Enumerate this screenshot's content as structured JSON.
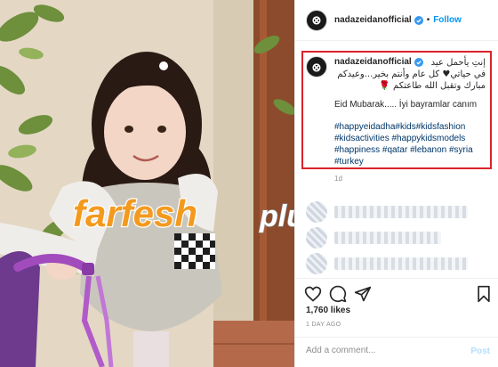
{
  "header": {
    "avatar_glyph": "⊗",
    "username": "nadazeidanofficial",
    "separator": "•",
    "follow_label": "Follow"
  },
  "caption": {
    "username": "nadazeidanofficial",
    "arabic_lines": [
      "إنتِ يأحمل عيد",
      "في حياتي♥ كل عام وأنتم بخير...وعيدكم",
      "مبارك وتقبل الله طاعتكم 🌹"
    ],
    "eid_line": "Eid Mubarak..... İyi bayramlar canım",
    "hashtags": [
      "#happyeidadha#kids#kidsfashion",
      "#kidsactivities #happykidsmodels",
      "#happiness #qatar #lebanon #syria",
      "#turkey"
    ],
    "age": "1d"
  },
  "likes": "1,760 likes",
  "post_age": "1 DAY AGO",
  "comment": {
    "placeholder": "Add a comment...",
    "post_label": "Post"
  },
  "watermark": {
    "part1": "farfesh",
    "part2": "plus.com"
  },
  "colors": {
    "accent": "#0095f6",
    "highlight_border": "#d9232a",
    "hashtag": "#00376b",
    "watermark_orange": "#f39a1e"
  }
}
